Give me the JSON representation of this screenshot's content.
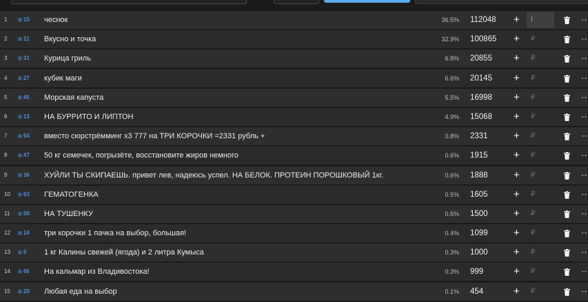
{
  "rows": [
    {
      "num": "1",
      "tag": "15",
      "name": "чеснок",
      "pct": "36.5%",
      "amount": "112048",
      "currency": "I",
      "active": true
    },
    {
      "num": "2",
      "tag": "21",
      "name": "Вкусно и точка",
      "pct": "32.9%",
      "amount": "100865",
      "currency": "₽"
    },
    {
      "num": "3",
      "tag": "31",
      "name": "Курица гриль",
      "pct": "6.8%",
      "amount": "20855",
      "currency": "₽"
    },
    {
      "num": "4",
      "tag": "27",
      "name": "кубик маги",
      "pct": "6.6%",
      "amount": "20145",
      "currency": "₽"
    },
    {
      "num": "5",
      "tag": "45",
      "name": "Морская капуста",
      "pct": "5.5%",
      "amount": "16998",
      "currency": "₽"
    },
    {
      "num": "6",
      "tag": "13",
      "name": "НА БУРРИТО И ЛИПТОН",
      "pct": "4.9%",
      "amount": "15068",
      "currency": "₽"
    },
    {
      "num": "7",
      "tag": "64",
      "name": "вместо сюрстрёмминг х3 777 на ТРИ КОРОЧКИ =2331 рубль +",
      "pct": "0.8%",
      "amount": "2331",
      "currency": "₽"
    },
    {
      "num": "8",
      "tag": "47",
      "name": "50 кг семечек, погрызёте, восстановите жиров немного",
      "pct": "0.6%",
      "amount": "1915",
      "currency": "₽"
    },
    {
      "num": "9",
      "tag": "36",
      "name": "ХУЙЛИ ТЫ СКИПАЕШЬ. привет лев, надеюсь успел. НА БЕЛОК. ПРОТЕИН ПОРОШКОВЫЙ 1кг.",
      "pct": "0.6%",
      "amount": "1888",
      "currency": "₽"
    },
    {
      "num": "10",
      "tag": "63",
      "name": "ГЕМАТОГЕНКА",
      "pct": "0.5%",
      "amount": "1605",
      "currency": "₽"
    },
    {
      "num": "11",
      "tag": "50",
      "name": " НА ТУШЕНКУ",
      "pct": "0.5%",
      "amount": "1500",
      "currency": "₽"
    },
    {
      "num": "12",
      "tag": "24",
      "name": "три корочки 1 пачка на выбор, большая!",
      "pct": "0.4%",
      "amount": "1099",
      "currency": "₽"
    },
    {
      "num": "13",
      "tag": "9",
      "name": "1 кг Калины свежей (ягода) и 2 литра Кумыса",
      "pct": "0.3%",
      "amount": "1000",
      "currency": "₽"
    },
    {
      "num": "14",
      "tag": "66",
      "name": "На кальмар из Владивостока!",
      "pct": "0.3%",
      "amount": "999",
      "currency": "₽"
    },
    {
      "num": "15",
      "tag": "20",
      "name": "Любая еда на выбор",
      "pct": "0.1%",
      "amount": "454",
      "currency": "₽"
    }
  ],
  "icons": {
    "add": "plus-icon",
    "delete": "trash-icon",
    "more": "more-icon",
    "tag": "hash-icon"
  },
  "colors": {
    "background": "#1b1b1b",
    "row": "#2b2b2b",
    "accent": "#4a90e2",
    "button": "#5aa9e8"
  }
}
